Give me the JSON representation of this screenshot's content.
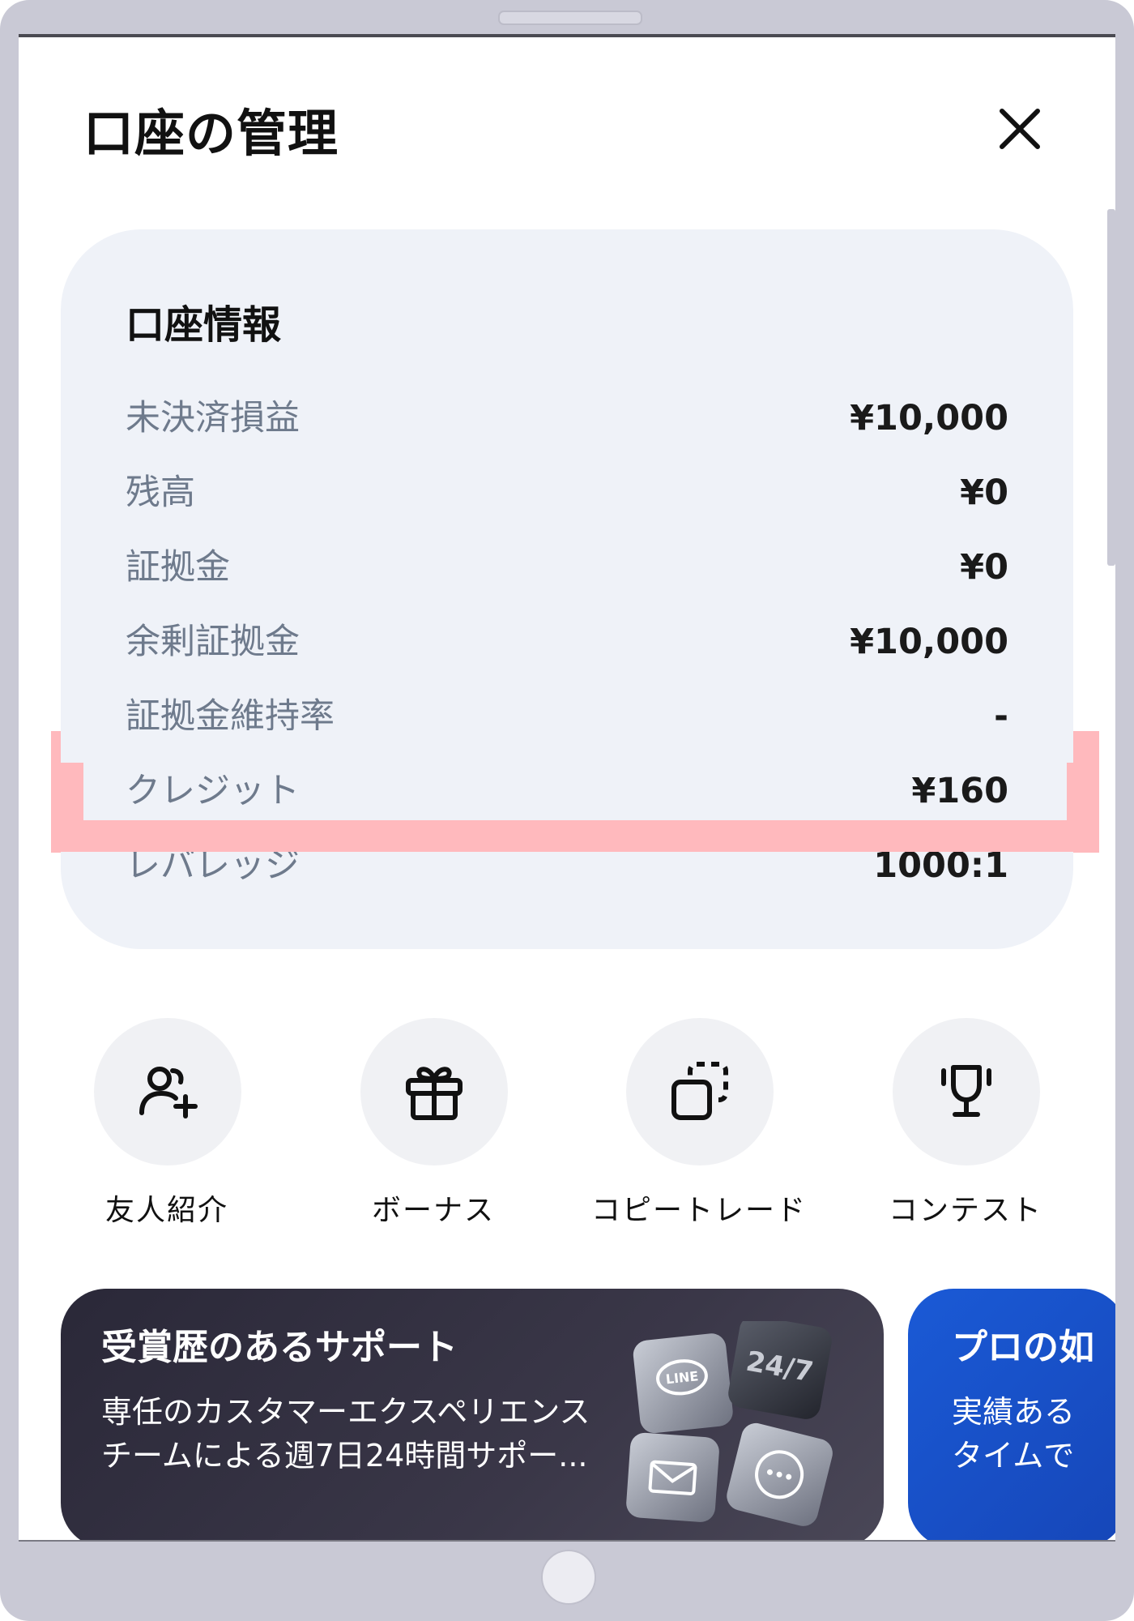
{
  "header": {
    "title": "口座の管理"
  },
  "account_info": {
    "title": "口座情報",
    "rows": [
      {
        "label": "未決済損益",
        "value": "¥10,000"
      },
      {
        "label": "残高",
        "value": "¥0"
      },
      {
        "label": "証拠金",
        "value": "¥0"
      },
      {
        "label": "余剰証拠金",
        "value": "¥10,000"
      },
      {
        "label": "証拠金維持率",
        "value": "-"
      },
      {
        "label": "クレジット",
        "value": "¥160"
      },
      {
        "label": "レバレッジ",
        "value": "1000:1"
      }
    ]
  },
  "quick_actions": [
    {
      "label": "友人紹介",
      "icon": "add-user-icon"
    },
    {
      "label": "ボーナス",
      "icon": "gift-icon"
    },
    {
      "label": "コピートレード",
      "icon": "copy-icon"
    },
    {
      "label": "コンテスト",
      "icon": "trophy-icon"
    }
  ],
  "promos": [
    {
      "title": "受賞歴のあるサポート",
      "text": "専任のカスタマーエクスペリエンス\nチームによる週7日24時間サポー...",
      "art_labels": {
        "line": "LINE",
        "hours": "24/7"
      }
    },
    {
      "title": "プロの如",
      "text": "実績ある\nタイムで"
    }
  ],
  "colors": {
    "card_bg": "#eff2f8",
    "label_gray": "#6e7a8c",
    "highlight": "#ffb9bd",
    "promo_dark": "#2a2838",
    "promo_blue": "#1a5ad6"
  }
}
